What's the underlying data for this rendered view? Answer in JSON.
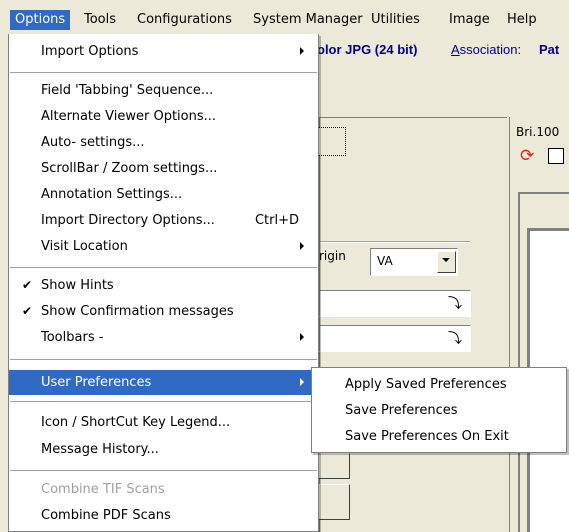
{
  "menubar": {
    "items": [
      "Options",
      "Tools",
      "Configurations",
      "System Manager",
      "Utilities",
      "Image",
      "Help"
    ]
  },
  "background": {
    "image_type": "olor JPG (24 bit)",
    "association_label": "Association:",
    "association_value": "Pat",
    "origin_label": "rigin",
    "origin_value": "VA",
    "bri_label": "Bri.100"
  },
  "options_menu": {
    "items": [
      {
        "label": "Import Options",
        "submenu": true
      },
      {
        "label": "Field 'Tabbing' Sequence..."
      },
      {
        "label": "Alternate Viewer Options..."
      },
      {
        "label": "Auto- settings..."
      },
      {
        "label": "ScrollBar / Zoom settings..."
      },
      {
        "label": "Annotation Settings..."
      },
      {
        "label": "Import Directory Options...",
        "shortcut": "Ctrl+D"
      },
      {
        "label": "Visit Location",
        "submenu": true
      },
      {
        "label": "Show Hints",
        "checked": true
      },
      {
        "label": "Show Confirmation messages",
        "checked": true
      },
      {
        "label": "Toolbars -",
        "submenu": true
      },
      {
        "label": "User Preferences",
        "submenu": true,
        "highlighted": true
      },
      {
        "label": "Icon / ShortCut Key Legend..."
      },
      {
        "label": "Message History..."
      },
      {
        "label": "Combine TIF Scans",
        "disabled": true
      },
      {
        "label": "Combine PDF Scans"
      }
    ],
    "check_glyph": "✔"
  },
  "user_preferences_submenu": {
    "items": [
      "Apply Saved Preferences",
      "Save Preferences",
      "Save Preferences On Exit"
    ]
  },
  "colors": {
    "highlight": "#316AC5",
    "window_bg": "#ECE9D8",
    "disabled_text": "#A0A0A0",
    "link_text": "#00008B"
  }
}
